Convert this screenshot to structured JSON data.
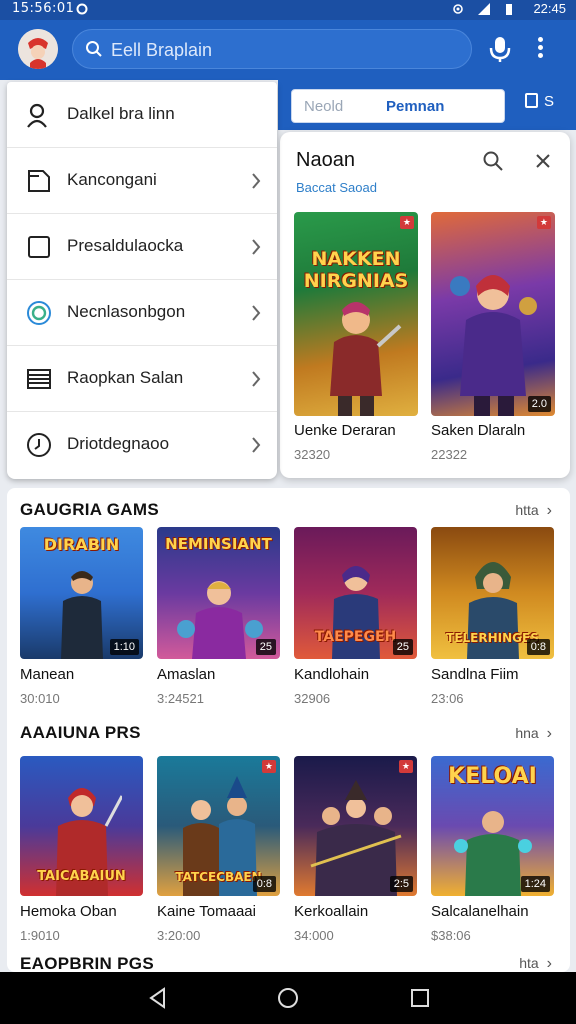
{
  "status_bar": {
    "time": "15:56:01",
    "right_time": "22:45",
    "icons": [
      "notification-icon",
      "wifi-icon",
      "signal-icon",
      "battery-icon"
    ]
  },
  "app_bar": {
    "search_placeholder": "Eell Braplain",
    "avatar_icon": "profile-avatar-icon"
  },
  "filter": {
    "option_a": "Neold",
    "option_b": "Pemnan",
    "extra_button": "S"
  },
  "drawer": {
    "items": [
      {
        "label": "Dalkel bra linn",
        "icon": "search-icon",
        "chevron": false
      },
      {
        "label": "Kancongani",
        "icon": "document-icon",
        "chevron": true
      },
      {
        "label": "Presaldulaocka",
        "icon": "square-icon",
        "chevron": true
      },
      {
        "label": "Necnlasonbgon",
        "icon": "circle-logo-icon",
        "chevron": true
      },
      {
        "label": "Raopkan Salan",
        "icon": "list-icon",
        "chevron": true
      },
      {
        "label": "Driotdegnaoo",
        "icon": "clock-icon",
        "chevron": true
      }
    ]
  },
  "result_panel": {
    "title": "Naoan",
    "subtitle": "Baccat Saoad",
    "items": [
      {
        "name": "Uenke Deraran",
        "price": "32320",
        "cover_text": "NAKKEN NIRGNIAS",
        "badge": "",
        "colors": [
          "#2a8a3a",
          "#e0a020"
        ]
      },
      {
        "name": "Saken Dlaraln",
        "price": "22322",
        "cover_text": "",
        "badge": "2.0",
        "colors": [
          "#6a3aa8",
          "#e08a30"
        ]
      }
    ]
  },
  "sections": [
    {
      "title": "GAUGRIA GAMS",
      "more": "htta",
      "items": [
        {
          "name": "Manean",
          "price": "30:010",
          "cover_text": "DIRABIN",
          "badge": "1:10",
          "colors": [
            "#2f6fd0",
            "#e9a84a"
          ]
        },
        {
          "name": "Amaslan",
          "price": "3:24521",
          "cover_text": "NEMINSIANT",
          "badge": "25",
          "colors": [
            "#3a2f8a",
            "#d25a9a"
          ]
        },
        {
          "name": "Kandlohain",
          "price": "32906",
          "cover_text": "TAEPEGEH",
          "badge": "25",
          "colors": [
            "#8a1a4a",
            "#e05a3a"
          ]
        },
        {
          "name": "Sandlna Fiim",
          "price": "23:06",
          "cover_text": "TELERHINGES",
          "badge": "0:8",
          "colors": [
            "#b85a10",
            "#f0c040"
          ]
        }
      ]
    },
    {
      "title": "AAAIUNA PRS",
      "more": "hna",
      "items": [
        {
          "name": "Hemoka Oban",
          "price": "1:9010",
          "cover_text": "TAICABAIUN",
          "badge": "",
          "colors": [
            "#2a5ac0",
            "#d03030"
          ]
        },
        {
          "name": "Kaine Tomaaai",
          "price": "3:20:00",
          "cover_text": "TATCECBAEN",
          "badge": "0:8",
          "colors": [
            "#1a7a9a",
            "#e0a040"
          ]
        },
        {
          "name": "Kerkoallain",
          "price": "34:000",
          "cover_text": "",
          "badge": "2:5",
          "colors": [
            "#2a2a6a",
            "#e07a30"
          ]
        },
        {
          "name": "Salcalanelhain",
          "price": "$38:06",
          "cover_text": "KELOAI",
          "badge": "1:24",
          "colors": [
            "#3a6ad0",
            "#f0b030"
          ]
        }
      ]
    },
    {
      "title": "EAOPBRIN PGS",
      "more": "hta",
      "items": []
    }
  ],
  "nav_bar": {
    "buttons": [
      "back-icon",
      "home-icon",
      "recents-icon"
    ]
  }
}
